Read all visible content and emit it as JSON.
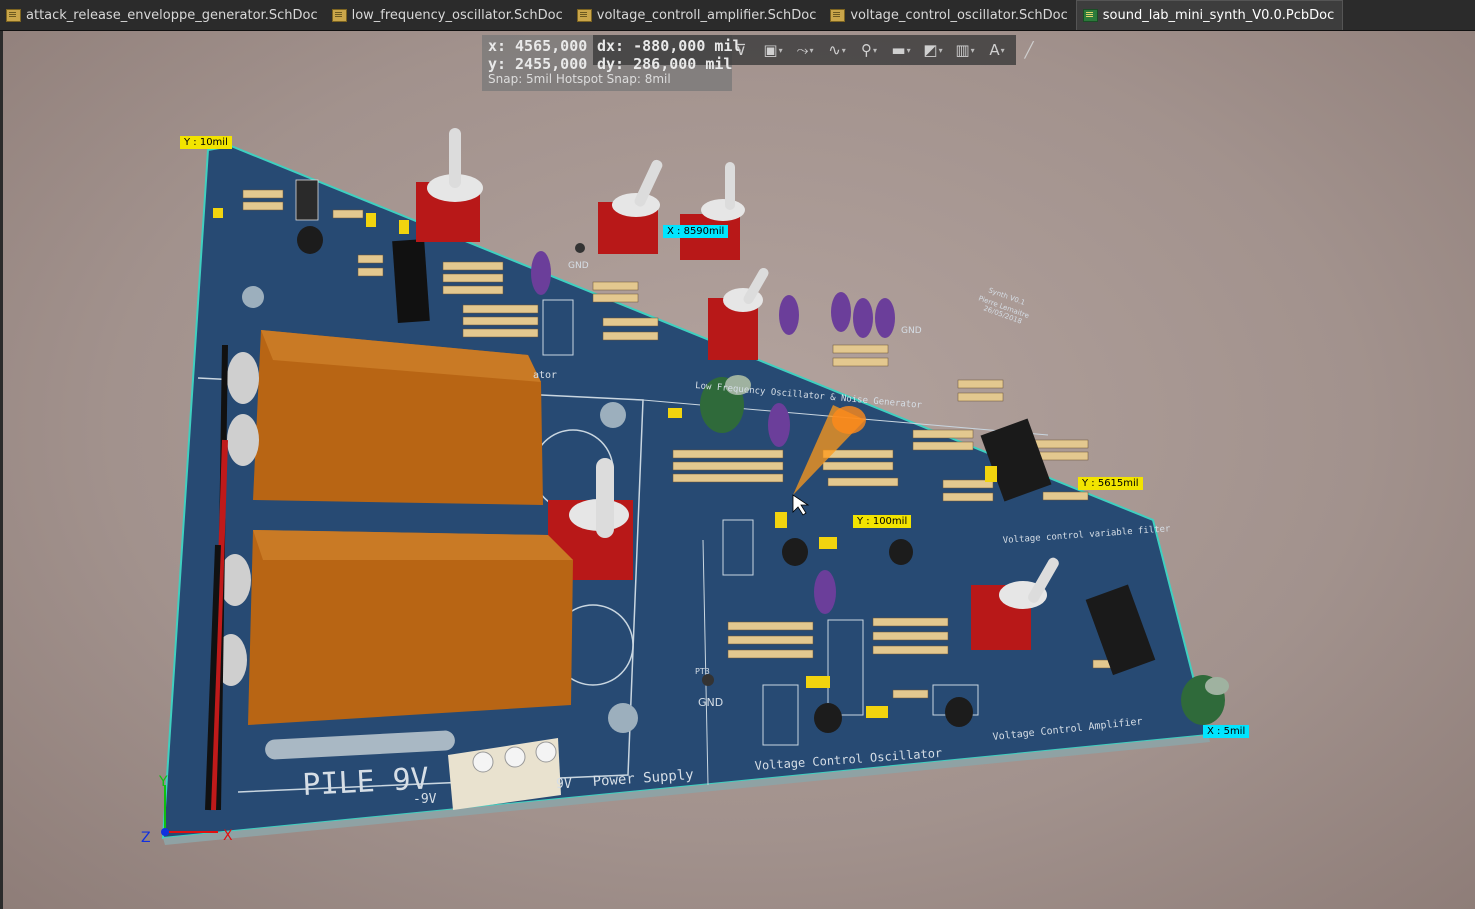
{
  "tabs": [
    {
      "label": "attack_release_enveloppe_generator.SchDoc",
      "type": "sch",
      "active": false
    },
    {
      "label": "low_frequency_oscillator.SchDoc",
      "type": "sch",
      "active": false
    },
    {
      "label": "voltage_controll_amplifier.SchDoc",
      "type": "sch",
      "active": false
    },
    {
      "label": "voltage_control_oscillator.SchDoc",
      "type": "sch",
      "active": false
    },
    {
      "label": "sound_lab_mini_synth_V0.0.PcbDoc",
      "type": "pcb",
      "active": true
    }
  ],
  "hud": {
    "x_label": "x:",
    "x_value": "4565,000",
    "y_label": "y:",
    "y_value": "2455,000",
    "dx_label": "dx:",
    "dx_value": "-880,000 mil",
    "dy_label": "dy:",
    "dy_value": "286,000 mil",
    "snap": "Snap: 5mil Hotspot Snap: 8mil"
  },
  "toolbar": {
    "items": [
      {
        "name": "filter-icon",
        "glyph": "⊽",
        "dropdown": false
      },
      {
        "name": "select-icon",
        "glyph": "▣",
        "dropdown": true
      },
      {
        "name": "route-icon",
        "glyph": "⤳",
        "dropdown": true
      },
      {
        "name": "interactive-route-icon",
        "glyph": "∿",
        "dropdown": true
      },
      {
        "name": "place-pad-icon",
        "glyph": "⚲",
        "dropdown": true
      },
      {
        "name": "place-fill-icon",
        "glyph": "▬",
        "dropdown": true
      },
      {
        "name": "polygon-icon",
        "glyph": "◩",
        "dropdown": true
      },
      {
        "name": "chart-icon",
        "glyph": "▥",
        "dropdown": true
      },
      {
        "name": "text-icon",
        "glyph": "A",
        "dropdown": true
      },
      {
        "name": "line-icon",
        "glyph": "╱",
        "dropdown": false
      }
    ]
  },
  "measures": {
    "y_top": "Y : 10mil",
    "x_top": "X : 8590mil",
    "y_right": "Y : 5615mil",
    "y_mid": "Y : 100mil",
    "x_bottom": "X : 5mil"
  },
  "silkscreen": {
    "pile": "PILE 9V",
    "minus9": "-9V",
    "plus9": "9V",
    "power_supply": "Power Supply",
    "vco": "Voltage Control Oscillator",
    "vca": "Voltage Control Amplifier",
    "vcf": "Voltage control variable filter",
    "lfo": "Low Frequency Oscillator & Noise Generator",
    "envelope_tail": "ator",
    "gnd1": "GND",
    "gnd2": "GND",
    "gnd3": "GND",
    "pt3": "PT3",
    "author1": "Synth V0.1",
    "author2": "Pierre Lemaitre",
    "author3": "26/05/2018"
  },
  "axes": {
    "x": "X",
    "y": "Y",
    "z": "Z"
  },
  "colors": {
    "board": "#274a73",
    "outline": "#3fd0c0",
    "battery": "#b86514",
    "switch": "#b81818"
  }
}
